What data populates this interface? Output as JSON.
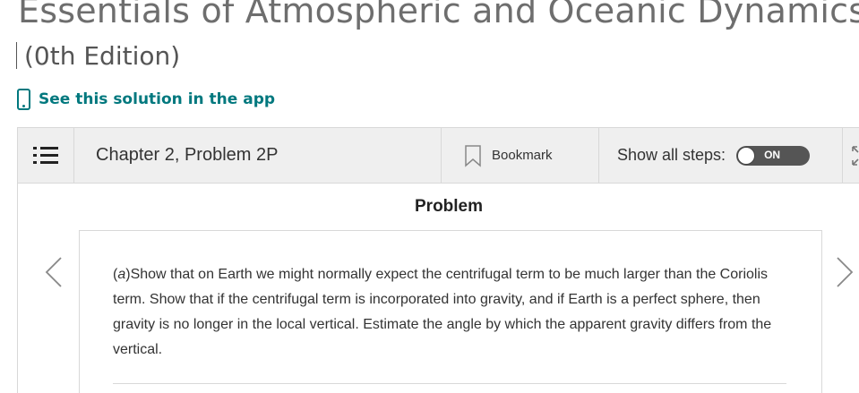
{
  "book": {
    "title": "Essentials of Atmospheric and Oceanic Dynamics",
    "edition": "(0th Edition)"
  },
  "app_link": {
    "label": "See this solution in the app"
  },
  "toolbar": {
    "chapter": "Chapter 2, Problem 2P",
    "bookmark_label": "Bookmark",
    "show_steps_label": "Show all steps:",
    "toggle_label": "ON"
  },
  "problem": {
    "heading": "Problem",
    "part_label": "a",
    "text": "Show that on Earth we might normally expect the centrifugal term to be much larger than the Coriolis term. Show that if the centrifugal term is incorporated into gravity, and if Earth is a perfect sphere, then gravity is no longer in the local vertical. Estimate the angle by which the apparent gravity differs from the vertical."
  },
  "colors": {
    "accent": "#00787e",
    "title_gray": "#6e6e6e",
    "toolbar_bg": "#efefef",
    "toggle_bg": "#555555"
  },
  "icons": {
    "app": "phone-icon",
    "menu": "list-icon",
    "bookmark": "bookmark-icon",
    "expand": "expand-icon",
    "prev": "chevron-left-icon",
    "next": "chevron-right-icon"
  }
}
